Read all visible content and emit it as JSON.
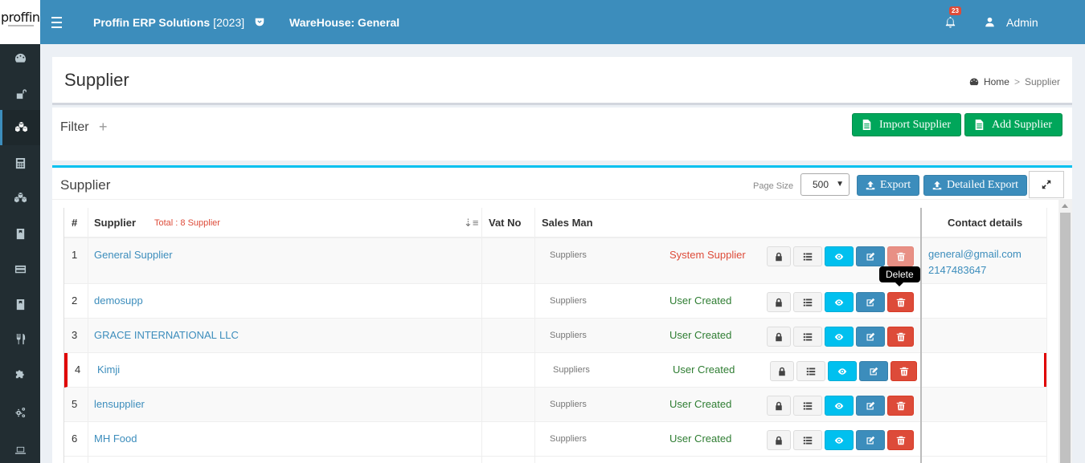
{
  "app": {
    "logo_text": "proffin",
    "title": "Proffin ERP Solutions",
    "year": "[2023]",
    "warehouse": "WareHouse: General",
    "notification_count": "23",
    "user": "Admin"
  },
  "sidebar": {
    "items": [
      {
        "icon": "dashboard-icon"
      },
      {
        "icon": "unlock-icon"
      },
      {
        "icon": "cubes-icon",
        "active": true
      },
      {
        "icon": "calculator-icon"
      },
      {
        "icon": "cubes-alt-icon"
      },
      {
        "icon": "book-icon"
      },
      {
        "icon": "credit-card-icon"
      },
      {
        "icon": "book-alt-icon"
      },
      {
        "icon": "cutlery-icon"
      },
      {
        "icon": "puzzle-icon"
      },
      {
        "icon": "cogs-icon"
      },
      {
        "icon": "laptop-icon"
      }
    ]
  },
  "page": {
    "title": "Supplier",
    "breadcrumb_home": "Home",
    "breadcrumb_sep": ">",
    "breadcrumb_current": "Supplier"
  },
  "filter": {
    "title": "Filter",
    "toggle": "+"
  },
  "actions": {
    "import_label": "Import Supplier",
    "add_label": "Add Supplier"
  },
  "list": {
    "title": "Supplier",
    "page_size_label": "Page Size",
    "page_size_value": "500",
    "export_label": "Export",
    "detailed_export_label": "Detailed Export"
  },
  "table": {
    "headers": {
      "num": "#",
      "supplier": "Supplier",
      "total": "Total : 8 Supplier",
      "vat": "Vat No",
      "salesman": "Sales Man",
      "contact": "Contact details"
    },
    "rows": [
      {
        "num": "1",
        "name": "General Supplier",
        "salesman": "Suppliers",
        "type": "System Supplier",
        "type_kind": "sys",
        "email": "general@gmail.com",
        "phone": "2147483647",
        "delete_disabled": true
      },
      {
        "num": "2",
        "name": "demosupp",
        "salesman": "Suppliers",
        "type": "User Created",
        "type_kind": "user",
        "email": "",
        "phone": ""
      },
      {
        "num": "3",
        "name": "GRACE INTERNATIONAL LLC",
        "salesman": "Suppliers",
        "type": "User Created",
        "type_kind": "user",
        "email": "",
        "phone": ""
      },
      {
        "num": "4",
        "name": "Kimji",
        "salesman": "Suppliers",
        "type": "User Created",
        "type_kind": "user",
        "email": "",
        "phone": "",
        "highlight": true
      },
      {
        "num": "5",
        "name": "lensupplier",
        "salesman": "Suppliers",
        "type": "User Created",
        "type_kind": "user",
        "email": "",
        "phone": ""
      },
      {
        "num": "6",
        "name": "MH Food",
        "salesman": "Suppliers",
        "type": "User Created",
        "type_kind": "user",
        "email": "",
        "phone": ""
      }
    ]
  },
  "tooltip": {
    "text": "Delete"
  },
  "colors": {
    "topbar": "#3c8dbc",
    "sidebar": "#222d32",
    "success": "#00a65a",
    "info": "#00c0ef",
    "danger": "#dd4b39",
    "user_created": "#2e7d32"
  }
}
